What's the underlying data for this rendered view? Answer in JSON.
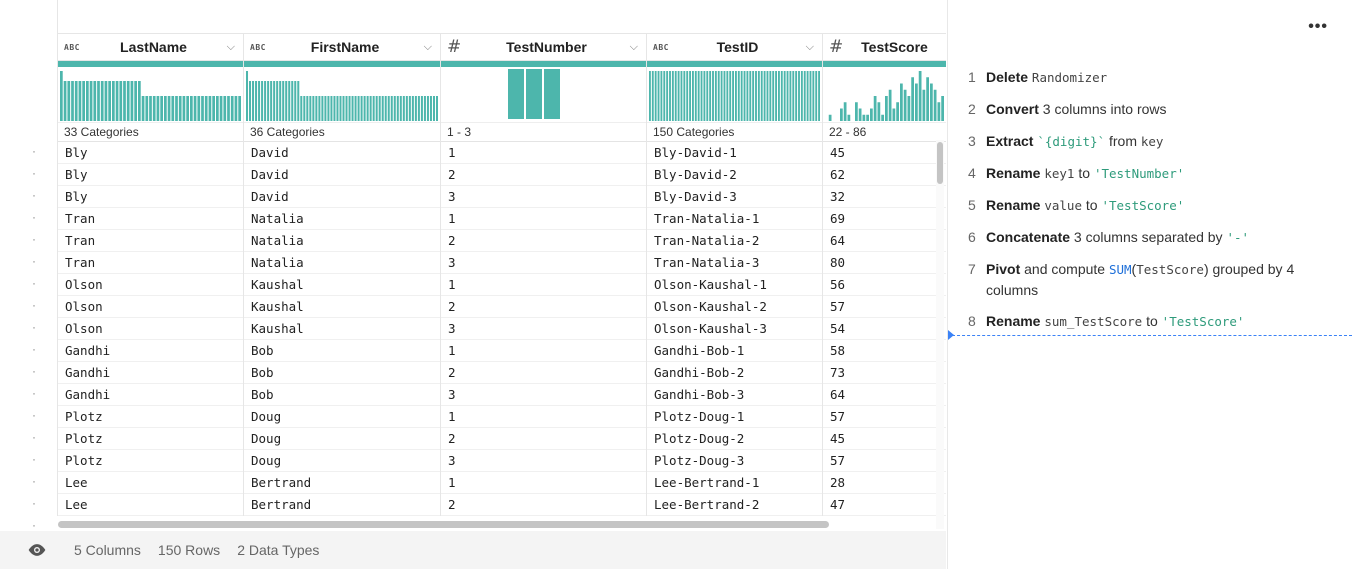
{
  "columns": [
    {
      "title": "LastName",
      "type": "ABC",
      "summary": "33 Categories",
      "histogram": [
        10,
        8,
        8,
        8,
        8,
        8,
        8,
        8,
        8,
        8,
        8,
        8,
        8,
        8,
        8,
        8,
        8,
        8,
        8,
        8,
        8,
        8,
        5,
        5,
        5,
        5,
        5,
        5,
        5,
        5,
        5,
        5,
        5,
        5,
        5,
        5,
        5,
        5,
        5,
        5,
        5,
        5,
        5,
        5,
        5,
        5,
        5,
        5,
        5
      ],
      "cells": [
        "Bly",
        "Bly",
        "Bly",
        "Tran",
        "Tran",
        "Tran",
        "Olson",
        "Olson",
        "Olson",
        "Gandhi",
        "Gandhi",
        "Gandhi",
        "Plotz",
        "Plotz",
        "Plotz",
        "Lee",
        "Lee"
      ]
    },
    {
      "title": "FirstName",
      "type": "ABC",
      "summary": "36 Categories",
      "histogram": [
        10,
        8,
        8,
        8,
        8,
        8,
        8,
        8,
        8,
        8,
        8,
        8,
        8,
        8,
        8,
        8,
        8,
        8,
        5,
        5,
        5,
        5,
        5,
        5,
        5,
        5,
        5,
        5,
        5,
        5,
        5,
        5,
        5,
        5,
        5,
        5,
        5,
        5,
        5,
        5,
        5,
        5,
        5,
        5,
        5,
        5,
        5,
        5,
        5,
        5,
        5,
        5,
        5,
        5,
        5,
        5,
        5,
        5,
        5,
        5,
        5,
        5,
        5,
        5
      ],
      "cells": [
        "David",
        "David",
        "David",
        "Natalia",
        "Natalia",
        "Natalia",
        "Kaushal",
        "Kaushal",
        "Kaushal",
        "Bob",
        "Bob",
        "Bob",
        "Doug",
        "Doug",
        "Doug",
        "Bertrand",
        "Bertrand"
      ]
    },
    {
      "title": "TestNumber",
      "type": "#",
      "summary": "1 - 3",
      "histogram": [
        1,
        1,
        1
      ],
      "cells": [
        "1",
        "2",
        "3",
        "1",
        "2",
        "3",
        "1",
        "2",
        "3",
        "1",
        "2",
        "3",
        "1",
        "2",
        "3",
        "1",
        "2"
      ]
    },
    {
      "title": "TestID",
      "type": "ABC",
      "summary": "150 Categories",
      "histogram": [
        1,
        1,
        1,
        1,
        1,
        1,
        1,
        1,
        1,
        1,
        1,
        1,
        1,
        1,
        1,
        1,
        1,
        1,
        1,
        1,
        1,
        1,
        1,
        1,
        1,
        1,
        1,
        1,
        1,
        1,
        1,
        1,
        1,
        1,
        1,
        1,
        1,
        1,
        1,
        1,
        1,
        1,
        1,
        1,
        1,
        1,
        1,
        1,
        1,
        1,
        1,
        1,
        1,
        1,
        1,
        1,
        1,
        1,
        1,
        1
      ],
      "cells": [
        "Bly-David-1",
        "Bly-David-2",
        "Bly-David-3",
        "Tran-Natalia-1",
        "Tran-Natalia-2",
        "Tran-Natalia-3",
        "Olson-Kaushal-1",
        "Olson-Kaushal-2",
        "Olson-Kaushal-3",
        "Gandhi-Bob-1",
        "Gandhi-Bob-2",
        "Gandhi-Bob-3",
        "Plotz-Doug-1",
        "Plotz-Doug-2",
        "Plotz-Doug-3",
        "Lee-Bertrand-1",
        "Lee-Bertrand-2"
      ]
    },
    {
      "title": "TestScore",
      "type": "#",
      "summary": "22 - 86",
      "histogram": [
        0,
        1,
        0,
        0,
        2,
        3,
        1,
        0,
        3,
        2,
        1,
        1,
        2,
        4,
        3,
        1,
        4,
        5,
        2,
        3,
        6,
        5,
        4,
        7,
        6,
        8,
        5,
        7,
        6,
        5,
        3,
        4
      ],
      "cells": [
        "45",
        "62",
        "32",
        "69",
        "64",
        "80",
        "56",
        "57",
        "54",
        "58",
        "73",
        "64",
        "57",
        "45",
        "57",
        "28",
        "47"
      ]
    }
  ],
  "row_count_visible": 17,
  "footer": {
    "columns": "5 Columns",
    "rows": "150 Rows",
    "types": "2 Data Types"
  },
  "recipe": {
    "more_label": "•••",
    "steps": [
      {
        "num": "1",
        "parts": [
          [
            "b",
            "Delete"
          ],
          [
            "t",
            " "
          ],
          [
            "mono",
            "Randomizer"
          ]
        ]
      },
      {
        "num": "2",
        "parts": [
          [
            "b",
            "Convert"
          ],
          [
            "t",
            " 3 columns into rows"
          ]
        ]
      },
      {
        "num": "3",
        "parts": [
          [
            "b",
            "Extract"
          ],
          [
            "t",
            " "
          ],
          [
            "str",
            "`{digit}`"
          ],
          [
            "t",
            " from "
          ],
          [
            "mono",
            "key"
          ]
        ]
      },
      {
        "num": "4",
        "parts": [
          [
            "b",
            "Rename"
          ],
          [
            "t",
            " "
          ],
          [
            "mono",
            "key1"
          ],
          [
            "t",
            " to "
          ],
          [
            "str",
            "'TestNumber'"
          ]
        ]
      },
      {
        "num": "5",
        "parts": [
          [
            "b",
            "Rename"
          ],
          [
            "t",
            " "
          ],
          [
            "mono",
            "value"
          ],
          [
            "t",
            " to "
          ],
          [
            "str",
            "'TestScore'"
          ]
        ]
      },
      {
        "num": "6",
        "parts": [
          [
            "b",
            "Concatenate"
          ],
          [
            "t",
            " 3 columns separated by "
          ],
          [
            "str",
            "'-'"
          ]
        ]
      },
      {
        "num": "7",
        "parts": [
          [
            "b",
            "Pivot"
          ],
          [
            "t",
            " and compute "
          ],
          [
            "fn",
            "SUM"
          ],
          [
            "t",
            "("
          ],
          [
            "mono",
            "TestScore"
          ],
          [
            "t",
            ") grouped by 4 columns"
          ]
        ]
      },
      {
        "num": "8",
        "parts": [
          [
            "b",
            "Rename"
          ],
          [
            "t",
            " "
          ],
          [
            "mono",
            "sum_TestScore"
          ],
          [
            "t",
            " to "
          ],
          [
            "str",
            "'TestScore'"
          ]
        ]
      }
    ]
  },
  "colors": {
    "accent": "#4db6ac",
    "string": "#2e9b7b",
    "function": "#1e6fd9",
    "cursor": "#3b82f6"
  },
  "icons": {
    "visibility": "eye-icon",
    "menu": "more-horizontal-icon",
    "dropdown": "chevron-down-icon"
  }
}
